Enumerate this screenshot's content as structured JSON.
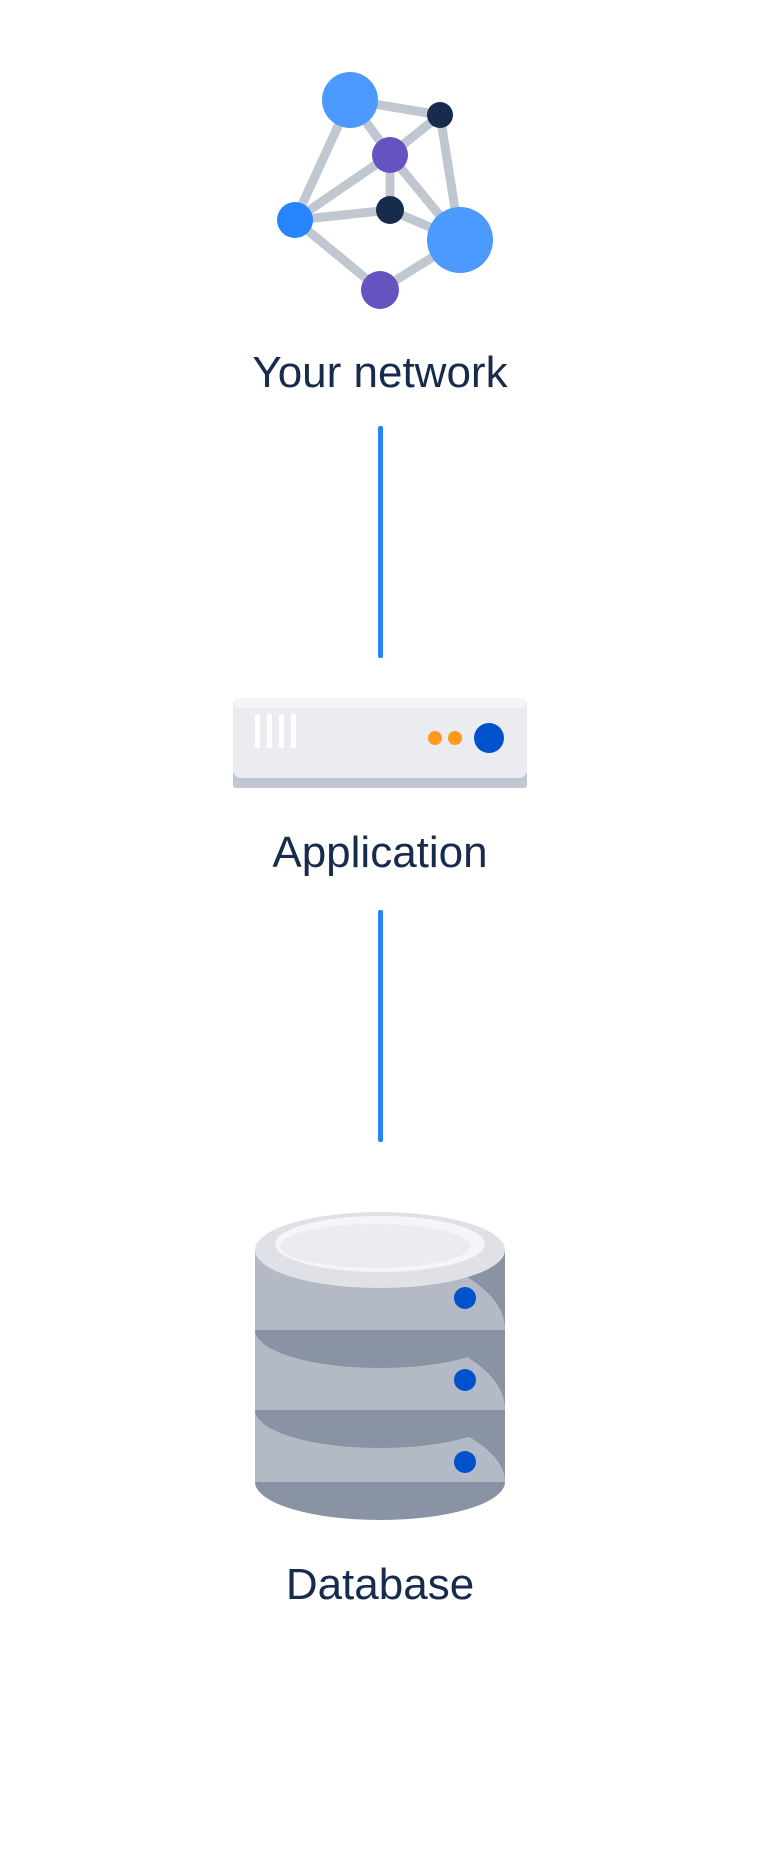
{
  "diagram": {
    "nodes": [
      {
        "id": "network",
        "label": "Your network",
        "icon": "network-graph-icon"
      },
      {
        "id": "application",
        "label": "Application",
        "icon": "server-icon"
      },
      {
        "id": "database",
        "label": "Database",
        "icon": "database-icon"
      }
    ],
    "edges": [
      {
        "from": "network",
        "to": "application"
      },
      {
        "from": "application",
        "to": "database"
      }
    ],
    "colors": {
      "label_text": "#172B4D",
      "connector": "#2684FF",
      "node_blue": "#4C9AFF",
      "node_blue_dark": "#2684FF",
      "node_purple": "#6554C0",
      "node_navy": "#172B4D",
      "server_body": "#EBECF0",
      "server_shadow": "#C1C7D0",
      "indicator_orange": "#FF991F",
      "indicator_blue": "#0052CC",
      "db_light": "#DFE1E6",
      "db_mid": "#B3BAC5",
      "db_dark": "#8993A4"
    }
  }
}
